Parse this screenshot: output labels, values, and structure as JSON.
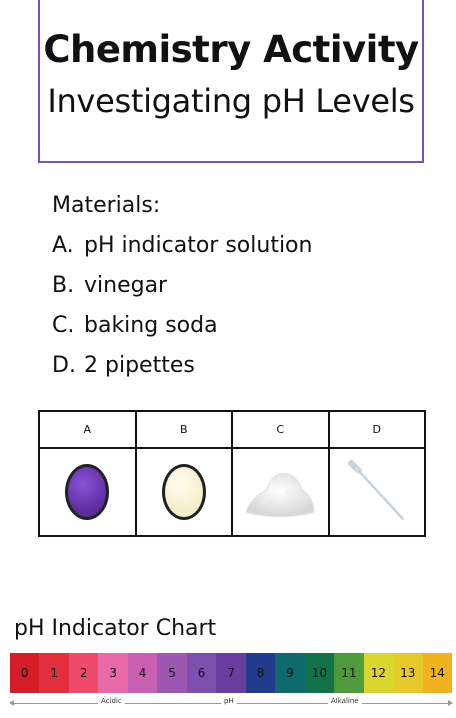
{
  "header": {
    "title": "Chemistry Activity",
    "subtitle": "Investigating pH Levels"
  },
  "materials": {
    "heading": "Materials:",
    "items": [
      {
        "letter": "A.",
        "text": "pH indicator solution"
      },
      {
        "letter": "B.",
        "text": "vinegar"
      },
      {
        "letter": "C.",
        "text": "baking soda"
      },
      {
        "letter": "D.",
        "text": "2 pipettes"
      }
    ]
  },
  "table": {
    "headers": [
      "A",
      "B",
      "C",
      "D"
    ],
    "images": [
      "purple-indicator-ball",
      "cream-vinegar-ball",
      "baking-soda-powder",
      "pipette"
    ]
  },
  "ph_chart": {
    "title": "pH Indicator Chart",
    "values": [
      "0",
      "1",
      "2",
      "3",
      "4",
      "5",
      "6",
      "7",
      "8",
      "9",
      "10",
      "11",
      "12",
      "13",
      "14"
    ],
    "colors": [
      "#d41f2a",
      "#e0303d",
      "#ee4b6a",
      "#e86aa6",
      "#c95fb0",
      "#9c58b0",
      "#7d4fae",
      "#6a3ea0",
      "#233b8c",
      "#0f6a6b",
      "#12734a",
      "#4f9a3a",
      "#d9d72e",
      "#e8c92b",
      "#f0b21f"
    ],
    "labels": {
      "acidic": "Acidic",
      "ph": "pH",
      "alkaline": "Alkaline"
    }
  }
}
